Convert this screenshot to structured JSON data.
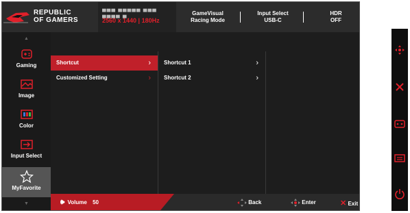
{
  "header": {
    "brand": "REPUBLIC OF GAMERS",
    "model_name": "▀▀▀ ▀▀▀▀▀ ▀▀▀ ▀▀▀▀ ▀",
    "resolution": "2560 x 1440 | 180Hz",
    "gamevisual_label": "GameVisual",
    "gamevisual_value": "Racing Mode",
    "input_label": "Input Select",
    "input_value": "USB-C",
    "hdr_label": "HDR",
    "hdr_value": "OFF"
  },
  "sidebar": {
    "items": [
      {
        "label": "Gaming",
        "icon": "gamepad-icon"
      },
      {
        "label": "Image",
        "icon": "image-icon"
      },
      {
        "label": "Color",
        "icon": "color-icon"
      },
      {
        "label": "Input Select",
        "icon": "input-select-icon"
      },
      {
        "label": "MyFavorite",
        "icon": "star-icon",
        "active": true
      }
    ]
  },
  "menu": {
    "level1": [
      {
        "label": "Shortcut",
        "active": true
      },
      {
        "label": "Customized Setting",
        "active": false
      }
    ],
    "level2": [
      {
        "label": "Shortcut 1"
      },
      {
        "label": "Shortcut 2"
      }
    ]
  },
  "footer": {
    "volume_label": "Volume",
    "volume_value": "50",
    "back_label": "Back",
    "enter_label": "Enter",
    "exit_label": "Exit"
  },
  "right_panel": {
    "icons": [
      "dpad-icon",
      "close-icon",
      "gamepad-icon",
      "input-icon",
      "power-icon"
    ]
  },
  "colors": {
    "accent": "#c0202a",
    "background": "#1a1a1a",
    "active_sidebar": "#555555"
  }
}
